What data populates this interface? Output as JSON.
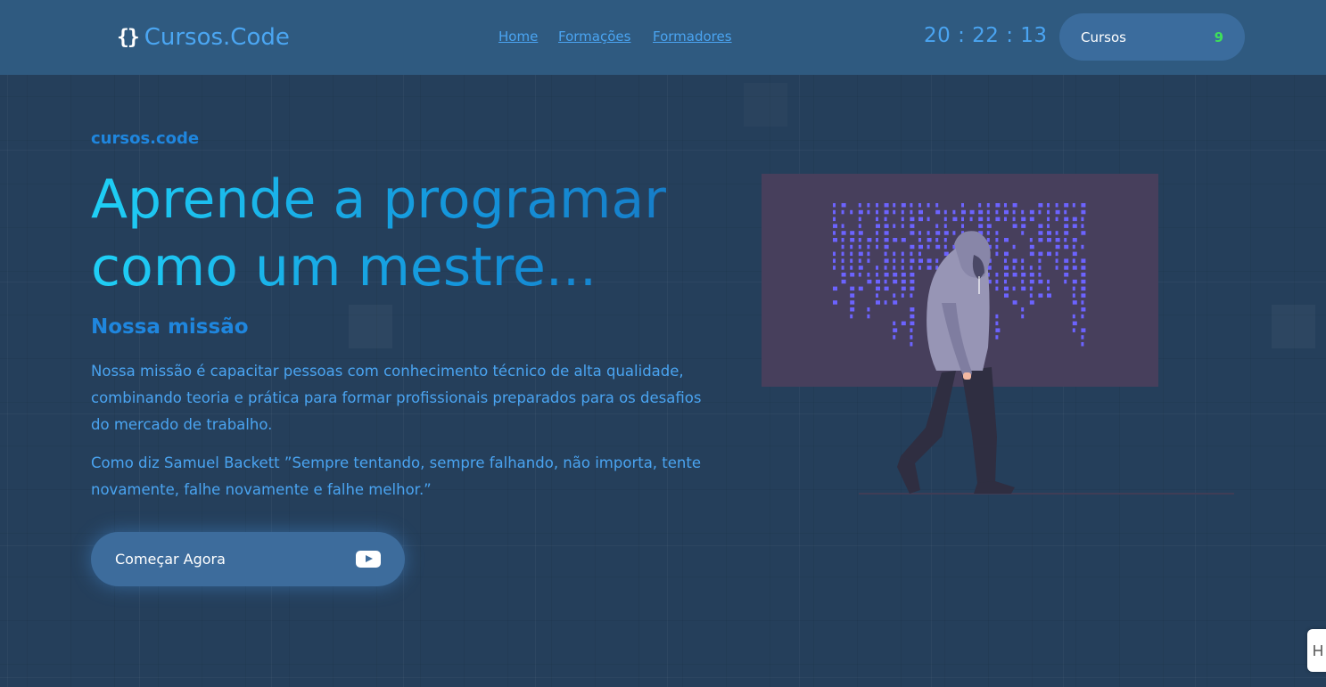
{
  "header": {
    "logo_icon": "{}",
    "logo_text": "Cursos.Code",
    "nav": [
      "Home",
      "Formações",
      "Formadores"
    ],
    "clock": "20 : 22 : 13",
    "cursos_button": {
      "label": "Cursos",
      "count": "9"
    }
  },
  "hero": {
    "eyebrow": "cursos.code",
    "headline_line1": "Aprende a programar",
    "headline_line2": "como um mestre...",
    "mission_title": "Nossa missão",
    "paragraph1": "Nossa missão é capacitar pessoas com conhecimento técnico de alta qualidade, combinando teoria e prática para formar profissionais preparados para os desafios do mercado de trabalho.",
    "paragraph2": "Como diz Samuel Backett ”Sempre tentando, sempre falhando, não importa, tente novamente, falhe novamente e falhe melhor.”",
    "cta_label": "Começar Agora",
    "cta_icon": "youtube-play-icon"
  },
  "colors": {
    "background": "#253f5b",
    "header": "#2f5a80",
    "link": "#4aa4f1",
    "accent": "#1f86de",
    "count": "#3ee05a",
    "matrix": "#6c63ff"
  },
  "illustration": "hacker-matrix-illustration"
}
